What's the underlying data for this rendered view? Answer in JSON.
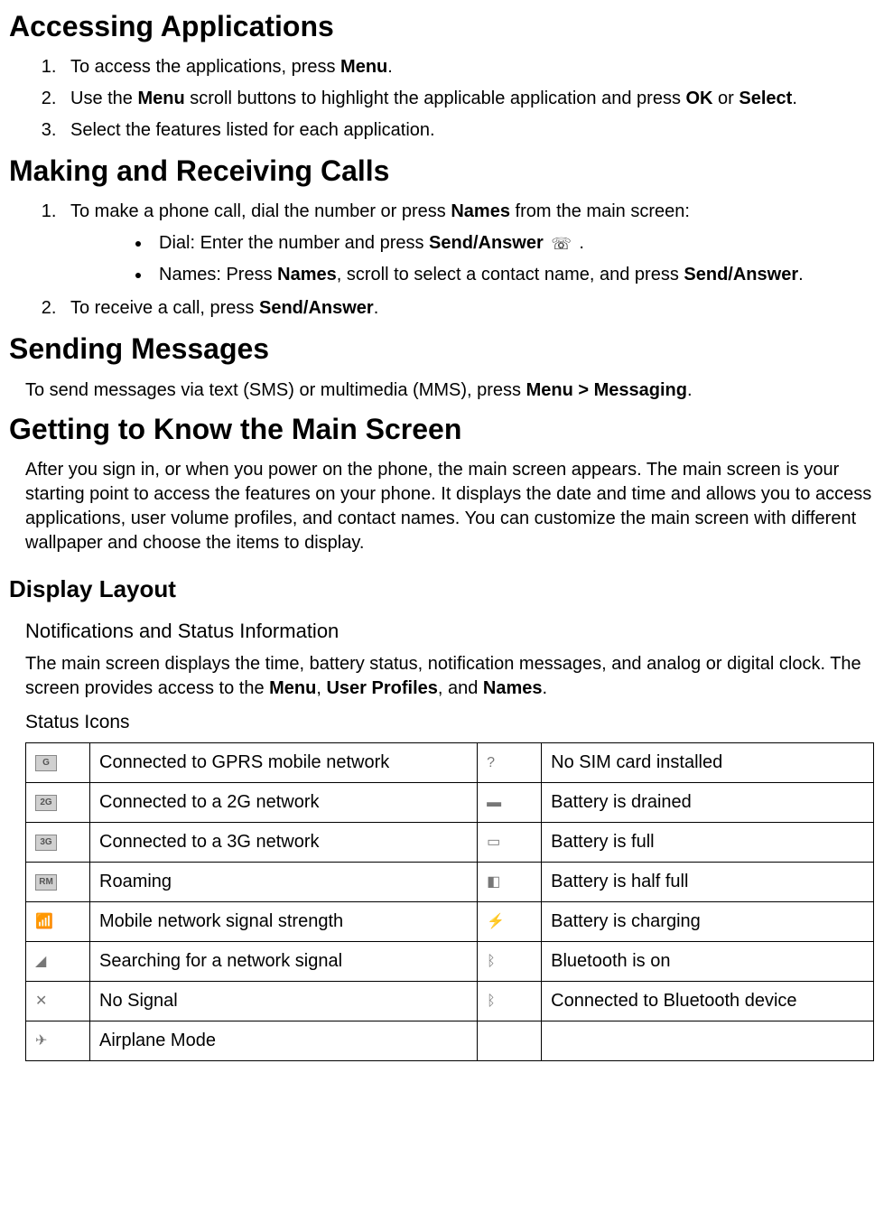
{
  "s1": {
    "title": "Accessing Applications",
    "items": [
      {
        "pre": "To access the applications, press ",
        "b1": "Menu",
        "post": "."
      },
      {
        "pre": "Use the ",
        "b1": "Menu",
        "mid": " scroll buttons to highlight the applicable application and press ",
        "b2": "OK",
        "or": " or ",
        "b3": "Select",
        "post": "."
      },
      {
        "pre": "Select the features listed for each application."
      }
    ]
  },
  "s2": {
    "title": "Making and Receiving Calls",
    "item1": {
      "pre": "To make a phone call, dial the number or press ",
      "b1": "Names",
      "post": " from the main screen:"
    },
    "bul1": {
      "pre": "Dial: Enter the number and press ",
      "b1": "Send/Answer",
      "glyph": "☏",
      "post": " ."
    },
    "bul2": {
      "pre": "Names: Press ",
      "b1": "Names",
      "mid": ", scroll to select a contact name, and press ",
      "b2": "Send/Answer",
      "post": "."
    },
    "item2": {
      "pre": "To receive a call, press ",
      "b1": "Send/Answer",
      "post": "."
    }
  },
  "s3": {
    "title": "Sending Messages",
    "para": {
      "pre": "To send messages via text (SMS) or multimedia (MMS), press ",
      "b1": "Menu > Messaging",
      "post": "."
    }
  },
  "s4": {
    "title": "Getting to  Know the  Main Screen",
    "para": "After you sign in, or when you power on the phone, the main screen appears. The main screen is your starting point to access the features on your phone. It displays the date and time and allows you to access applications, user volume profiles, and contact names. You can customize the main screen with different wallpaper and choose the items to display."
  },
  "s5": {
    "title": "Display Layout",
    "sub1": "Notifications and  Status Information",
    "para": {
      "pre": "The main screen displays the time, battery status, notification messages, and analog or digital clock. The screen provides access to the ",
      "b1": "Menu",
      "c1": ", ",
      "b2": "User Profiles",
      "c2": ", and ",
      "b3": "Names",
      "post": "."
    },
    "sub2": "Status Icons"
  },
  "icons": {
    "rows": [
      {
        "l_icon": "G",
        "l_text": "Connected to GPRS mobile network",
        "r_icon": "?",
        "r_text": "No SIM card installed"
      },
      {
        "l_icon": "2G",
        "l_text": "Connected to a 2G network",
        "r_icon": "▬",
        "r_text": "Battery is drained"
      },
      {
        "l_icon": "3G",
        "l_text": "Connected to a 3G network",
        "r_icon": "▭",
        "r_text": "Battery is full"
      },
      {
        "l_icon": "RM",
        "l_text": "Roaming",
        "r_icon": "◧",
        "r_text": "Battery is half full"
      },
      {
        "l_icon": "📶",
        "l_text": "Mobile network signal strength",
        "r_icon": "⚡",
        "r_text": "Battery is charging"
      },
      {
        "l_icon": "◢",
        "l_text": "Searching for a network signal",
        "r_icon": "ᛒ",
        "r_text": "Bluetooth is on"
      },
      {
        "l_icon": "✕",
        "l_text": "No Signal",
        "r_icon": "ᛒ",
        "r_text": "Connected to Bluetooth device"
      },
      {
        "l_icon": "✈",
        "l_text": "Airplane Mode",
        "r_icon": "",
        "r_text": ""
      }
    ]
  }
}
